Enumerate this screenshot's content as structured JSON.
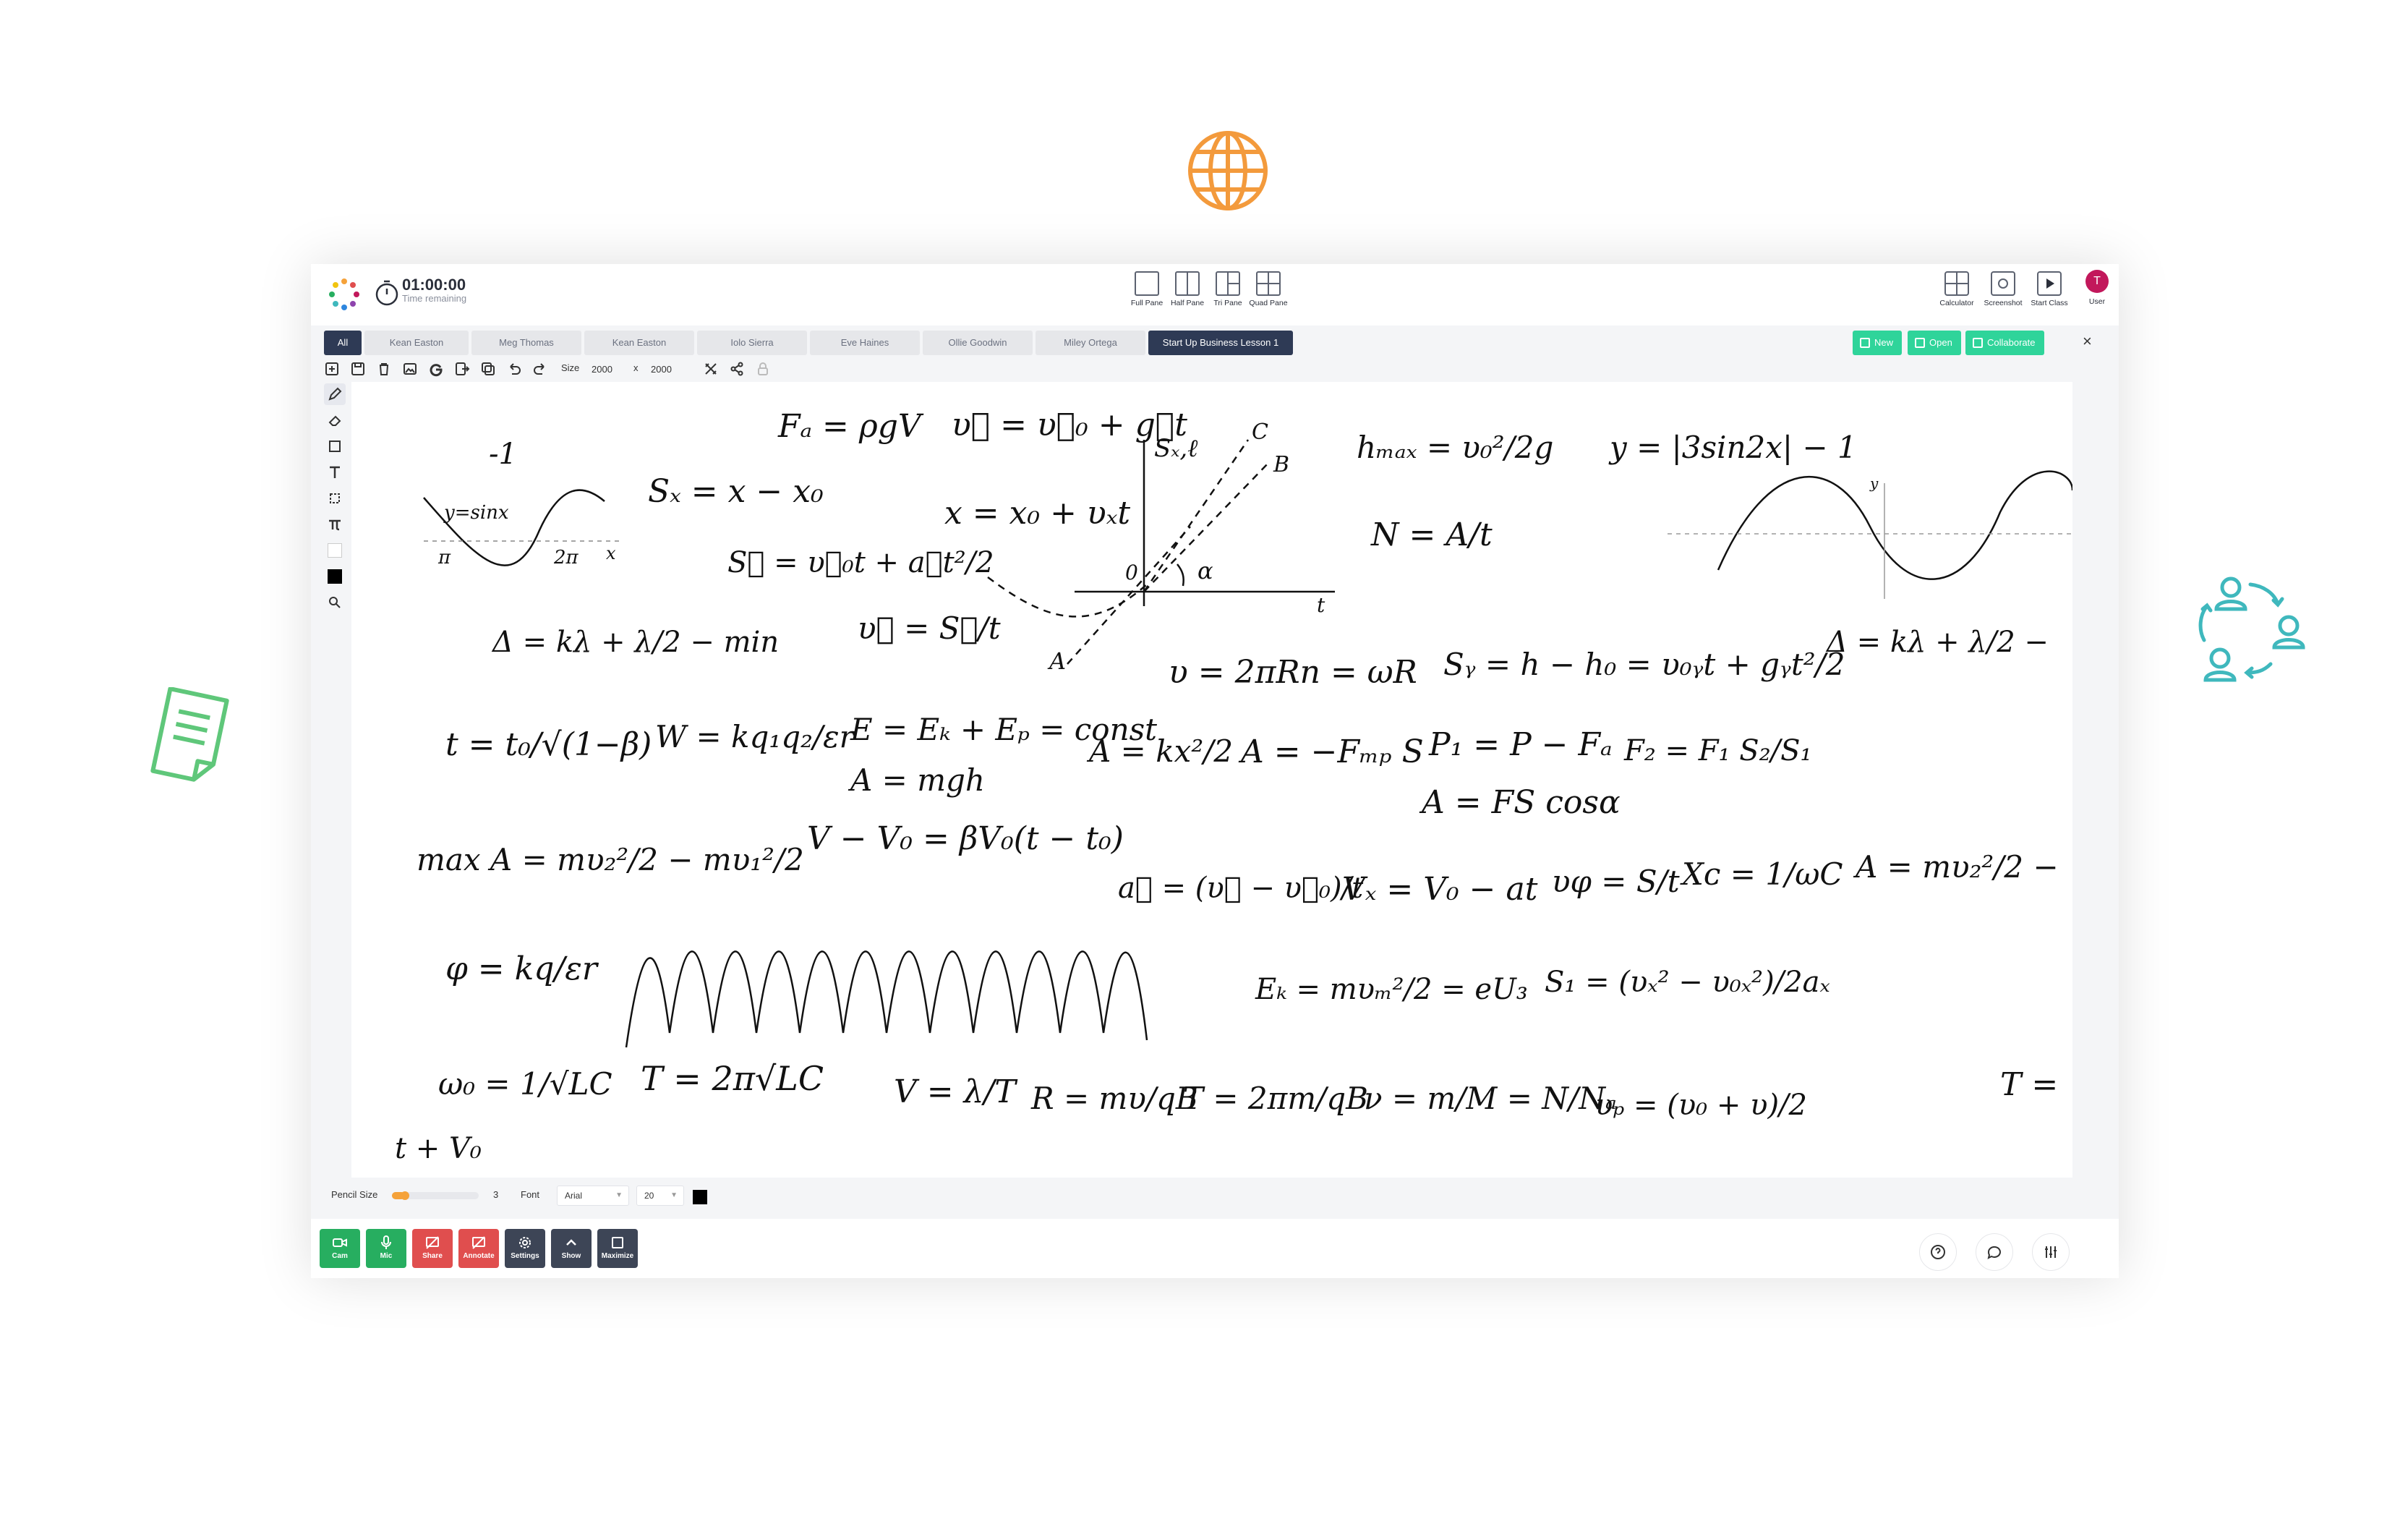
{
  "timer": {
    "value": "01:00:00",
    "label": "Time remaining"
  },
  "panes": [
    {
      "label": "Full Pane"
    },
    {
      "label": "Half Pane"
    },
    {
      "label": "Tri Pane"
    },
    {
      "label": "Quad Pane"
    }
  ],
  "tools": [
    {
      "label": "Calculator"
    },
    {
      "label": "Screenshot"
    },
    {
      "label": "Start Class"
    }
  ],
  "user": {
    "initial": "T",
    "label": "User"
  },
  "tabs": [
    "All",
    "Kean Easton",
    "Meg Thomas",
    "Kean Easton",
    "Iolo Sierra",
    "Eve Haines",
    "Ollie Goodwin",
    "Miley Ortega",
    "Start Up Business Lesson 1"
  ],
  "actions": {
    "new": "New",
    "open": "Open",
    "collaborate": "Collaborate"
  },
  "close_label": "×",
  "toolbar": {
    "size_label": "Size",
    "width": "2000",
    "x_label": "x",
    "height": "2000"
  },
  "options": {
    "pencil_size_label": "Pencil Size",
    "pencil_size": 3,
    "pencil_max": 20,
    "font_label": "Font",
    "font": "Arial",
    "font_size": "20",
    "color": "#000000"
  },
  "controls": [
    {
      "label": "Cam",
      "icon": "camera-icon"
    },
    {
      "label": "Mic",
      "icon": "mic-icon"
    },
    {
      "label": "Share",
      "icon": "share-screen-icon"
    },
    {
      "label": "Annotate",
      "icon": "annotate-icon"
    },
    {
      "label": "Settings",
      "icon": "gear-icon"
    },
    {
      "label": "Show",
      "icon": "chevron-up-icon"
    },
    {
      "label": "Maximize",
      "icon": "maximize-icon"
    }
  ],
  "board": {
    "formulas": [
      "-1",
      "y=sinx",
      "Sₓ = x − x₀",
      "Fₐ = ρgV",
      "υ⃗ = υ⃗₀ + g⃗t",
      "x = x₀ + υₓt",
      "S⃗ = υ⃗₀t + a⃗t²/2",
      "υ⃗ = S⃗/t",
      "hₘₐₓ = υ₀²/2g",
      "N = A/t",
      "y = |3sin2x| − 1",
      "Δ = kλ + λ/2 − min",
      "υ = 2πRn = ωR",
      "Sᵧ = h − h₀ = υ₀ᵧt + gᵧt²/2",
      "Δ = kλ + λ/2 −",
      "t = t₀/√(1−β)",
      "W = kq₁q₂/εr",
      "E = Eₖ + Eₚ = const",
      "A = mgh",
      "A = kx²/2",
      "A = −Fₘₚ S",
      "P₁ = P − Fₐ",
      "F₂ = F₁ S₂/S₁",
      "A = FS cosα",
      "max  A = mυ₂²/2 − mυ₁²/2",
      "V − V₀ = βV₀(t − t₀)",
      "a⃗ = (υ⃗ − υ⃗₀)/t",
      "Vₓ = V₀ − at",
      "υφ = S/t",
      "Xᴄ = 1/ωC",
      "A = mυ₂²/2 −",
      "φ = kq/εr",
      "Eₖ = mυₘ²/2 = eU₃",
      "S₁ = (υₓ² − υ₀ₓ²)/2aₓ",
      "ω₀ = 1/√LC",
      "T = 2π√LC",
      "V = λ/T",
      "R = mυ/qB",
      "T = 2πm/qB",
      "ν = m/M = N/Nₐ",
      "υₚ = (υ₀ + υ)/2",
      "T =",
      "t + V₀",
      "Sₓ,ℓ",
      "C",
      "B",
      "0",
      "α",
      "A",
      "t",
      "π",
      "2π",
      "x",
      "y"
    ]
  }
}
